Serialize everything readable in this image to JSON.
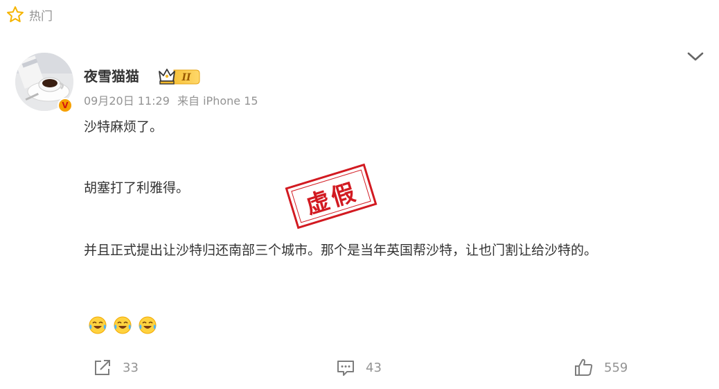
{
  "header": {
    "hot_label": "热门"
  },
  "post": {
    "username": "夜雪猫猫",
    "level_badge": "II",
    "date": "09月20日 11:29",
    "source": "来自 iPhone 15",
    "verified_badge": "V",
    "paragraphs": [
      "沙特麻烦了。",
      "胡塞打了利雅得。",
      "并且正式提出让沙特归还南部三个城市。那个是当年英国帮沙特，让也门割让给沙特的。"
    ],
    "emoji_names": [
      "laugh-cry-emoji",
      "laugh-cry-emoji",
      "laugh-cry-emoji"
    ],
    "stamp_text": "虚假"
  },
  "actions": {
    "share_count": "33",
    "comment_count": "43",
    "like_count": "559"
  },
  "colors": {
    "meta_gray": "#939393",
    "text": "#333333",
    "stamp_red": "#d21a21",
    "hot_star": "#f5b400",
    "badge_orange": "#f6a000"
  }
}
